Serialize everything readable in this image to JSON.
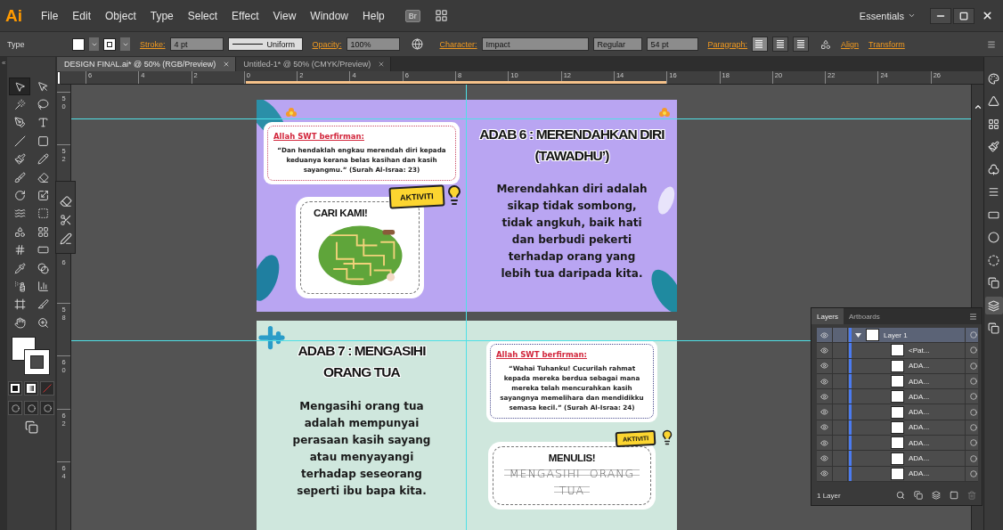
{
  "app": {
    "logo": "Ai",
    "menu": [
      "File",
      "Edit",
      "Object",
      "Type",
      "Select",
      "Effect",
      "View",
      "Window",
      "Help"
    ],
    "bridge": "Br",
    "workspace": "Essentials"
  },
  "control_bar": {
    "selection": "Type",
    "stroke_label": "Stroke:",
    "stroke_weight": "4 pt",
    "stroke_profile": "Uniform",
    "opacity_label": "Opacity:",
    "opacity": "100%",
    "character_label": "Character:",
    "font": "Impact",
    "font_style": "Regular",
    "font_size": "54 pt",
    "paragraph_label": "Paragraph:",
    "alignment": [
      {
        "selected": true
      },
      {
        "selected": false
      },
      {
        "selected": false
      }
    ],
    "links": [
      "Align",
      "Transform"
    ]
  },
  "tabs": [
    {
      "label": "DESIGN FINAL.ai* @ 50% (RGB/Preview)",
      "selected": true
    },
    {
      "label": "Untitled-1* @ 50% (CMYK/Preview)",
      "selected": false
    }
  ],
  "toolbox": {
    "collapse": "«",
    "tools": [
      {
        "kind": "selection",
        "selected": true
      },
      {
        "kind": "direct-selection",
        "selected": false
      },
      {
        "kind": "wand",
        "selected": false
      },
      {
        "kind": "lasso",
        "selected": false
      },
      {
        "kind": "pen",
        "selected": false
      },
      {
        "kind": "type",
        "selected": false
      },
      {
        "kind": "line",
        "selected": false
      },
      {
        "kind": "rectangle",
        "selected": false
      },
      {
        "kind": "paintbrush",
        "selected": false
      },
      {
        "kind": "pencil",
        "selected": false
      },
      {
        "kind": "blob-brush",
        "selected": false
      },
      {
        "kind": "eraser",
        "selected": false
      },
      {
        "kind": "rotate",
        "selected": false
      },
      {
        "kind": "scale",
        "selected": false
      },
      {
        "kind": "warp",
        "selected": false
      },
      {
        "kind": "free-transform",
        "selected": false
      },
      {
        "kind": "shape-builder",
        "selected": false
      },
      {
        "kind": "perspective",
        "selected": false
      },
      {
        "kind": "mesh",
        "selected": false
      },
      {
        "kind": "gradient",
        "selected": false
      },
      {
        "kind": "eyedropper",
        "selected": false
      },
      {
        "kind": "blend",
        "selected": false
      },
      {
        "kind": "spray",
        "selected": false
      },
      {
        "kind": "graph",
        "selected": false
      },
      {
        "kind": "artboard",
        "selected": false
      },
      {
        "kind": "slice",
        "selected": false
      },
      {
        "kind": "hand",
        "selected": false
      },
      {
        "kind": "zoom",
        "selected": false
      }
    ]
  },
  "floating_tools": [
    {
      "kind": "eraser"
    },
    {
      "kind": "scissors"
    },
    {
      "kind": "knife"
    }
  ],
  "rulers": {
    "horizontal": [
      "6",
      "4",
      "2",
      "0",
      "2",
      "4",
      "6",
      "8",
      "10",
      "12",
      "14",
      "16",
      "18",
      "20",
      "22",
      "24",
      "26"
    ],
    "vertical": {
      "above_panel": [
        "50",
        "52"
      ],
      "below_panel": [
        "6",
        "58",
        "60",
        "62",
        "64"
      ]
    }
  },
  "spreads": [
    {
      "pages": [
        {
          "kind": "quote",
          "quote_title": "Allah SWT berfirman:",
          "quote": "“Dan hendaklah engkau merendah diri kepada keduanya kerana belas kasihan dan kasih sayangmu.” (Surah Al-Israa: 23)",
          "activity": {
            "kind": "maze",
            "badge": "AKTIVITI",
            "title": "CARI KAMI!"
          }
        },
        {
          "kind": "lesson",
          "title": "ADAB 6 : MERENDAHKAN DIRI (TAWADHU’)",
          "body": "Merendahkan diri adalah sikap tidak sombong, tidak angkuh, baik hati dan berbudi pekerti terhadap orang yang lebih tua daripada kita."
        }
      ]
    },
    {
      "pages": [
        {
          "kind": "lesson",
          "title": "ADAB 7 : MENGASIHI ORANG TUA",
          "body": "Mengasihi orang tua adalah mempunyai perasaan kasih sayang atau menyayangi terhadap seseorang seperti ibu bapa kita."
        },
        {
          "kind": "quote",
          "quote_title": "Allah SWT berfirman:",
          "quote": "“Wahai Tuhanku! Cucurilah rahmat kepada mereka berdua sebagai mana mereka telah mencurahkan kasih sayangnya memelihara dan mendidikku semasa kecil.” (Surah Al-Israa: 24)",
          "activity": {
            "kind": "tracing",
            "badge": "AKTIVITI",
            "title": "MENULIS!",
            "lines": [
              "MENGASIHI  ORANG",
              "TUA"
            ]
          }
        }
      ]
    }
  ],
  "layers_panel": {
    "tabs": [
      {
        "label": "Layers",
        "selected": true
      },
      {
        "label": "Artboards",
        "selected": false
      }
    ],
    "layers": [
      {
        "name": "Layer 1",
        "expanded": true,
        "selected": true,
        "children": [
          {
            "name": "<Pat..."
          },
          {
            "name": "ADA..."
          },
          {
            "name": "ADA..."
          },
          {
            "name": "ADA..."
          },
          {
            "name": "ADA..."
          },
          {
            "name": "ADA..."
          },
          {
            "name": "ADA..."
          },
          {
            "name": "ADA..."
          },
          {
            "name": "ADA..."
          }
        ]
      }
    ],
    "footer": "1 Layer"
  },
  "dock": [
    {
      "kind": "color",
      "selected": false
    },
    {
      "kind": "color-guide",
      "selected": false
    },
    {
      "kind": "swatches",
      "selected": false
    },
    {
      "kind": "brushes",
      "selected": false
    },
    {
      "kind": "symbols",
      "selected": false
    },
    {
      "kind": "stroke",
      "selected": false
    },
    {
      "kind": "gradient",
      "selected": false
    },
    {
      "kind": "transparency",
      "selected": false
    },
    {
      "kind": "appearance",
      "selected": false
    },
    {
      "kind": "graphic-styles",
      "selected": false
    },
    {
      "kind": "layers",
      "selected": true
    },
    {
      "kind": "artboards",
      "selected": false
    }
  ]
}
